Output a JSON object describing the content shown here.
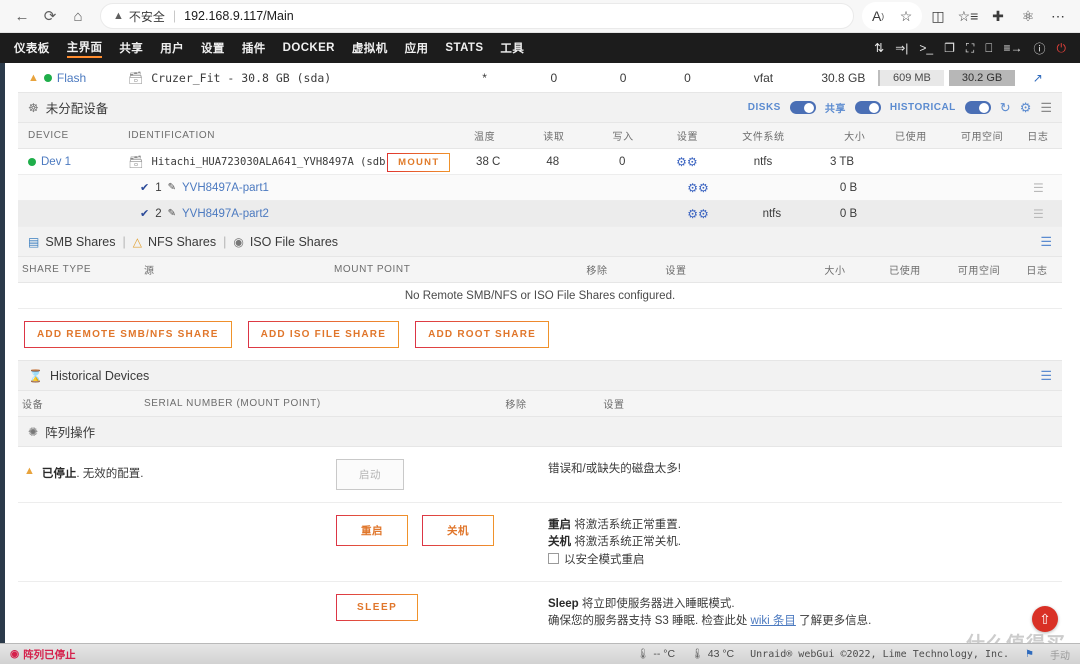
{
  "browser": {
    "back_icon": "back-arrow-icon",
    "reload_icon": "reload-icon",
    "home_icon": "home-icon",
    "security_label": "不安全",
    "url": "192.168.9.117/Main",
    "toolbar_icons": [
      "read-aloud-icon",
      "favorite-star-icon",
      "split-screen-icon",
      "collections-icon",
      "browser-essentials-icon",
      "extensions-icon",
      "more-options-icon"
    ]
  },
  "nav": {
    "items": [
      {
        "label": "仪表板",
        "active": false
      },
      {
        "label": "主界面",
        "active": true
      },
      {
        "label": "共享",
        "active": false
      },
      {
        "label": "用户",
        "active": false
      },
      {
        "label": "设置",
        "active": false
      },
      {
        "label": "插件",
        "active": false
      },
      {
        "label": "DOCKER",
        "active": false
      },
      {
        "label": "虚拟机",
        "active": false
      },
      {
        "label": "应用",
        "active": false
      },
      {
        "label": "STATS",
        "active": false
      },
      {
        "label": "工具",
        "active": false
      }
    ],
    "right_icons": [
      "update-icon",
      "login-icon",
      "terminal-icon",
      "copy-icon",
      "chat-icon",
      "display-icon",
      "log-icon",
      "help-icon",
      "power-icon"
    ]
  },
  "flash": {
    "status_icon": "warning-triangle-icon",
    "device_label": "Flash",
    "identification": "Cruzer_Fit - 30.8 GB (sda)",
    "temp": "*",
    "reads": "0",
    "writes": "0",
    "errors": "0",
    "fs": "vfat",
    "size": "30.8 GB",
    "used": "609 MB",
    "free": "30.2 GB",
    "log_icon": "external-link-icon"
  },
  "unassigned": {
    "title": "未分配设备",
    "icon": "unassigned-devices-icon",
    "toggles": [
      {
        "label": "DISKS",
        "on": true
      },
      {
        "label": "共享",
        "on": true
      },
      {
        "label": "HISTORICAL",
        "on": true
      }
    ],
    "tool_icons": [
      "refresh-icon",
      "settings-gear-icon",
      "list-menu-icon"
    ],
    "columns": [
      "DEVICE",
      "IDENTIFICATION",
      "温度",
      "读取",
      "写入",
      "设置",
      "文件系统",
      "大小",
      "已使用",
      "可用空间",
      "日志"
    ],
    "rows": [
      {
        "device": "Dev 1",
        "identification": "Hitachi_HUA723030ALA641_YVH8497A (sdb)",
        "mount_button": "MOUNT",
        "temp": "38 C",
        "reads": "48",
        "writes": "0",
        "settings_icon": "gears-icon",
        "fs": "ntfs",
        "size": "3 TB",
        "used": "",
        "free": "",
        "log": ""
      },
      {
        "index": "1",
        "name": "YVH8497A-part1",
        "settings_icon": "gears-icon",
        "fs": "",
        "size": "0 B",
        "log_icon": "log-file-icon"
      },
      {
        "index": "2",
        "name": "YVH8497A-part2",
        "settings_icon": "gears-icon",
        "fs": "ntfs",
        "size": "0 B",
        "log_icon": "log-file-icon"
      }
    ]
  },
  "shares": {
    "tabs": [
      {
        "label": "SMB Shares",
        "icon": "windows-icon"
      },
      {
        "label": "NFS Shares",
        "icon": "linux-tux-icon"
      },
      {
        "label": "ISO File Shares",
        "icon": "disc-icon"
      }
    ],
    "menu_icon": "list-menu-icon",
    "columns": [
      "SHARE TYPE",
      "源",
      "MOUNT POINT",
      "移除",
      "设置",
      "大小",
      "已使用",
      "可用空间",
      "日志"
    ],
    "empty_text": "No Remote SMB/NFS or ISO File Shares configured.",
    "buttons": [
      "ADD REMOTE SMB/NFS SHARE",
      "ADD ISO FILE SHARE",
      "ADD ROOT SHARE"
    ]
  },
  "historical": {
    "title": "Historical Devices",
    "icon": "hourglass-icon",
    "menu_icon": "list-menu-icon",
    "columns": [
      "设备",
      "SERIAL NUMBER (MOUNT POINT)",
      "移除",
      "设置"
    ]
  },
  "array_ops": {
    "title": "阵列操作",
    "icon": "asterisk-icon",
    "status_icon": "warning-triangle-icon",
    "status_bold": "已停止",
    "status_rest": ". 无效的配置.",
    "start_button": "启动",
    "start_note": "错误和/或缺失的磁盘太多!",
    "reboot_button": "重启",
    "shutdown_button": "关机",
    "reboot_note_bold": "重启",
    "reboot_note_rest": " 将激活系统正常重置.",
    "shutdown_note_bold": "关机",
    "shutdown_note_rest": " 将激活系统正常关机.",
    "safe_mode_label": "以安全模式重启",
    "sleep_button": "SLEEP",
    "sleep_note_bold": "Sleep",
    "sleep_note_rest": " 将立即使服务器进入睡眠模式.",
    "sleep_note_line2_a": "确保您的服务器支持 S3 睡眠. 检查此处 ",
    "sleep_wiki_link": "wiki 条目",
    "sleep_note_line2_b": " 了解更多信息."
  },
  "statusbar": {
    "array_status": "阵列已停止",
    "status_icon": "stopped-dot-icon",
    "cpu_temp": "-- °C",
    "mb_temp": "43 °C",
    "copyright": "Unraid® webGui ©2022, Lime Technology, Inc.",
    "lang_label": "手动",
    "scroll_top_icon": "scroll-to-top-icon",
    "watermark": "什么值得买"
  }
}
